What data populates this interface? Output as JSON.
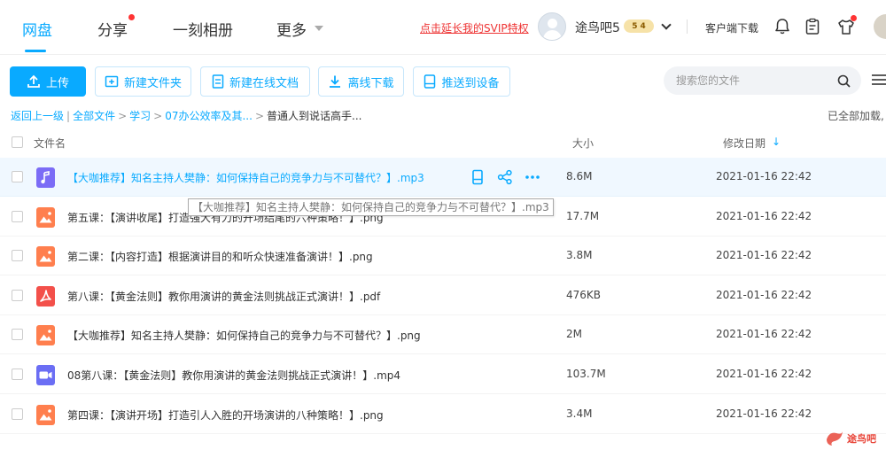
{
  "nav": {
    "tabs": [
      {
        "label": "网盘",
        "active": true
      },
      {
        "label": "分享",
        "has_dot": true
      },
      {
        "label": "一刻相册"
      },
      {
        "label": "更多"
      }
    ],
    "svip_link": "点击延长我的SVIP特权",
    "username": "途鸟吧5",
    "badge_level": "5",
    "badge_sub": "4",
    "client_download": "客户端下载",
    "icons": [
      "bell-icon",
      "clipboard-icon",
      "shirt-icon"
    ]
  },
  "toolbar": {
    "upload": "上传",
    "new_folder": "新建文件夹",
    "new_online_doc": "新建在线文档",
    "offline_download": "离线下载",
    "push_to_device": "推送到设备",
    "search_placeholder": "搜索您的文件"
  },
  "breadcrumb": {
    "back": "返回上一级",
    "items": [
      "全部文件",
      "学习",
      "07办公效率及其..."
    ],
    "current": "普通人到说话高手..."
  },
  "loaded_status": "已全部加载,",
  "table": {
    "headers": {
      "name": "文件名",
      "size": "大小",
      "date": "修改日期"
    },
    "rows": [
      {
        "type": "audio",
        "name": "【大咖推荐】知名主持人樊静：如何保持自己的竞争力与不可替代？】.mp3",
        "size": "8.6M",
        "date": "2021-01-16 22:42"
      },
      {
        "type": "image",
        "name": "第五课：【演讲收尾】打造强大有力的开场结尾的六种策略！】.png",
        "size": "17.7M",
        "date": "2021-01-16 22:42"
      },
      {
        "type": "image",
        "name": "第二课：【内容打造】根据演讲目的和听众快速准备演讲！】.png",
        "size": "3.8M",
        "date": "2021-01-16 22:42"
      },
      {
        "type": "pdf",
        "name": "第八课：【黄金法则】教你用演讲的黄金法则挑战正式演讲！】.pdf",
        "size": "476KB",
        "date": "2021-01-16 22:42"
      },
      {
        "type": "image",
        "name": "【大咖推荐】知名主持人樊静：如何保持自己的竞争力与不可替代？】.png",
        "size": "2M",
        "date": "2021-01-16 22:42"
      },
      {
        "type": "video",
        "name": "08第八课：【黄金法则】教你用演讲的黄金法则挑战正式演讲！】.mp4",
        "size": "103.7M",
        "date": "2021-01-16 22:42"
      },
      {
        "type": "image",
        "name": "第四课：【演讲开场】打造引人入胜的开场演讲的八种策略！】.png",
        "size": "3.4M",
        "date": "2021-01-16 22:42"
      }
    ]
  },
  "tooltip": "【大咖推荐】知名主持人樊静：如何保持自己的竞争力与不可替代？】.mp3",
  "watermark": "途鸟吧",
  "colors": {
    "accent": "#09aaff",
    "audio": "#7b6cf6",
    "image": "#ff7f4e",
    "pdf": "#f3504a",
    "video": "#6b6ef4",
    "link_red": "#e33"
  }
}
